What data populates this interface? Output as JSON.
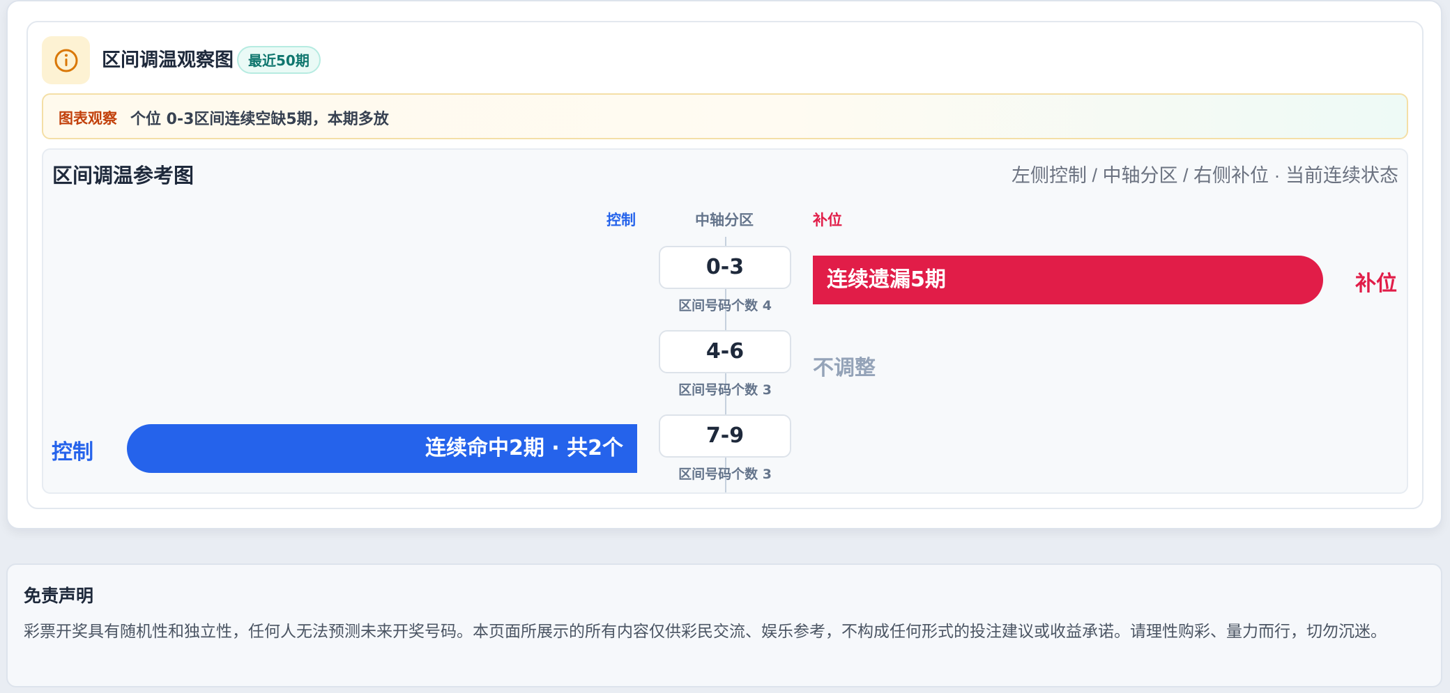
{
  "header": {
    "title": "区间调温观察图",
    "badge": "最近50期",
    "icon": "info-icon",
    "accent_color": "#d97706"
  },
  "observation": {
    "tag": "图表观察",
    "text": "个位 0-3区间连续空缺5期，本期多放"
  },
  "chart_panel": {
    "title": "区间调温参考图",
    "legend": "左侧控制 / 中轴分区 / 右侧补位 · 当前连续状态",
    "columns": {
      "control": "控制",
      "axis": "中轴分区",
      "fill": "补位"
    },
    "colors": {
      "control": "#2563eb",
      "fill": "#e11d48",
      "neutral": "#94a3b8"
    },
    "rows": [
      {
        "range": "0-3",
        "count_label": "区间号码个数 4",
        "status": "fill",
        "bar_text": "连续遗漏5期",
        "side_label": "补位"
      },
      {
        "range": "4-6",
        "count_label": "区间号码个数 3",
        "status": "none",
        "neutral_text": "不调整"
      },
      {
        "range": "7-9",
        "count_label": "区间号码个数 3",
        "status": "control",
        "bar_text": "连续命中2期 · 共2个",
        "side_label": "控制"
      }
    ]
  },
  "disclaimer": {
    "title": "免责声明",
    "text": "彩票开奖具有随机性和独立性，任何人无法预测未来开奖号码。本页面所展示的所有内容仅供彩民交流、娱乐参考，不构成任何形式的投注建议或收益承诺。请理性购彩、量力而行，切勿沉迷。"
  }
}
